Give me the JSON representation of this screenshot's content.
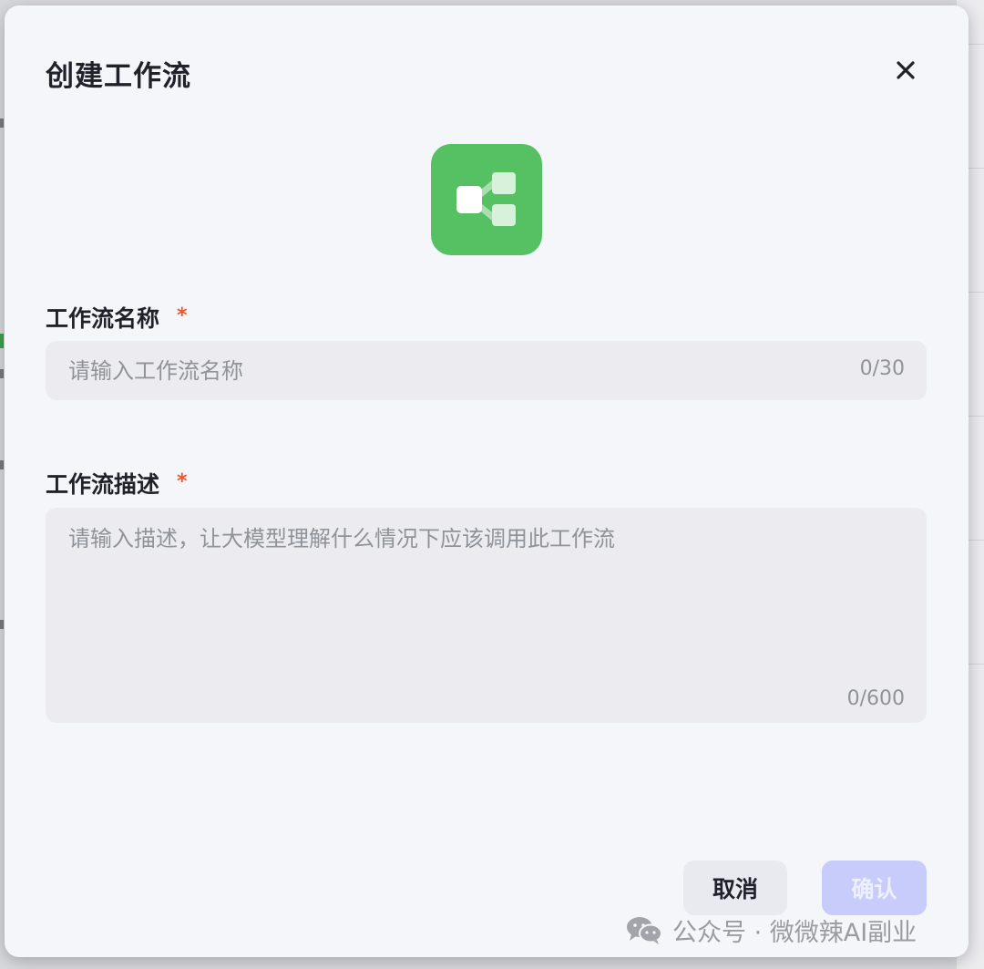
{
  "modal": {
    "title": "创建工作流",
    "icon": "workflow-icon",
    "close_icon": "close-icon"
  },
  "name_field": {
    "label": "工作流名称",
    "required_mark": "*",
    "placeholder": "请输入工作流名称",
    "value": "",
    "counter": "0/30"
  },
  "description_field": {
    "label": "工作流描述",
    "required_mark": "*",
    "placeholder": "请输入描述，让大模型理解什么情况下应该调用此工作流",
    "value": "",
    "counter": "0/600"
  },
  "buttons": {
    "cancel_label": "取消",
    "confirm_label": "确认"
  },
  "watermark": {
    "icon": "wechat-icon",
    "text": "公众号 · 微微辣AI副业"
  },
  "colors": {
    "accent_icon_bg": "#55c163",
    "confirm_disabled_bg": "#c7ccfb",
    "required_star": "#f0562e"
  }
}
